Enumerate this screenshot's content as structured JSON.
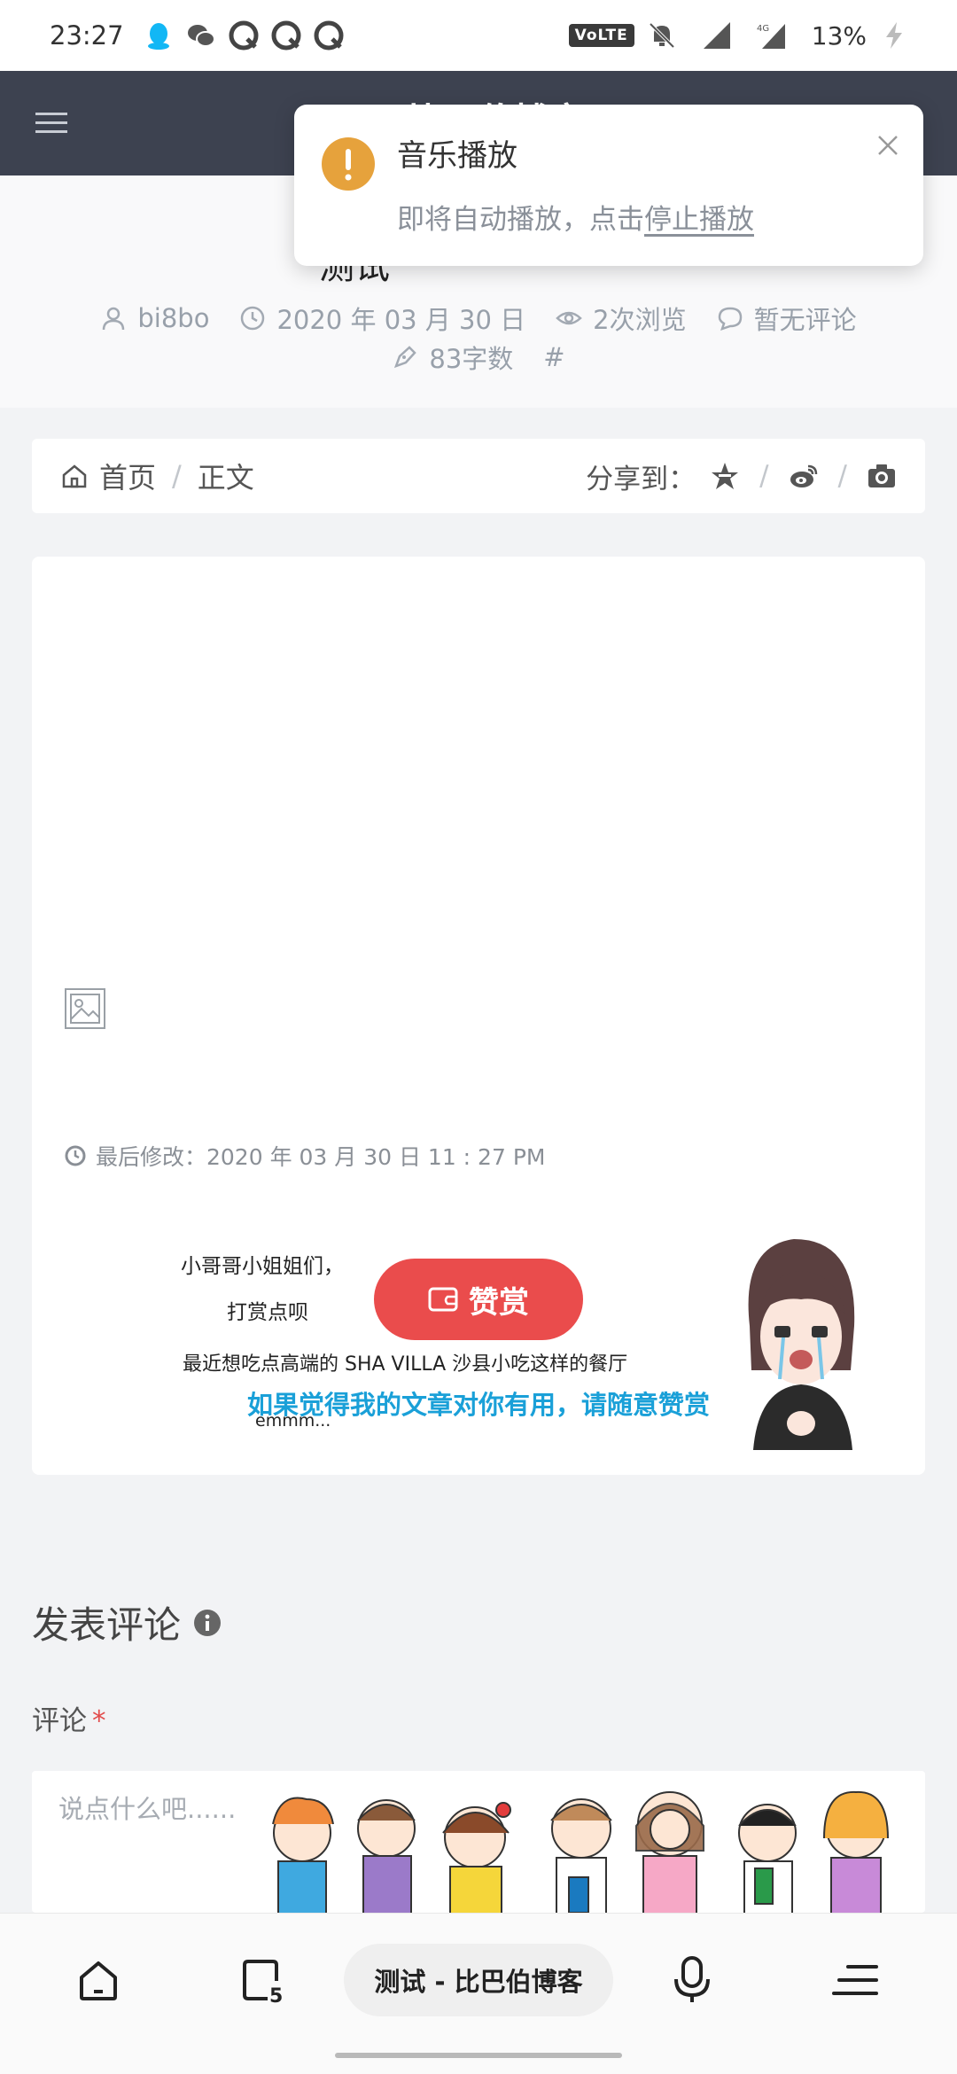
{
  "status_bar": {
    "time": "23:27",
    "network_badge": "VoLTE",
    "battery": "13%"
  },
  "header": {
    "title": "比巴伯博客"
  },
  "post": {
    "title_fragment": "测试",
    "author": "bi8bo",
    "date": "2020 年 03 月 30 日",
    "views": "2次浏览",
    "comments": "暂无评论",
    "word_count": "83字数",
    "tag_symbol": "#"
  },
  "breadcrumb": {
    "home": "首页",
    "separator": "/",
    "current": "正文",
    "share_label": "分享到："
  },
  "article": {
    "last_modified": "最后修改：2020 年 03 月 30 日 11 : 27 PM",
    "reward_button": "赞赏",
    "reward_caption": "如果觉得我的文章对你有用，请随意赞赏",
    "reward_image_lines": [
      "小哥哥小姐姐们，",
      "打赏点呗",
      "最近想吃点高端的 SHA VILLA 沙县小吃这样的餐厅",
      "emmm..."
    ]
  },
  "comment": {
    "heading": "发表评论",
    "label": "评论",
    "required_mark": "*",
    "placeholder": "说点什么吧......"
  },
  "browser_bar": {
    "url_text": "测试 - 比巴伯博客",
    "tabs_count": "5"
  },
  "toast": {
    "title": "音乐播放",
    "message": "即将自动播放，点击",
    "link": "停止播放"
  },
  "colors": {
    "header_bg": "#3d4250",
    "reward_red": "#ea4c4c",
    "caption_blue": "#1aa0d8",
    "warning_orange": "#e6a23c"
  }
}
